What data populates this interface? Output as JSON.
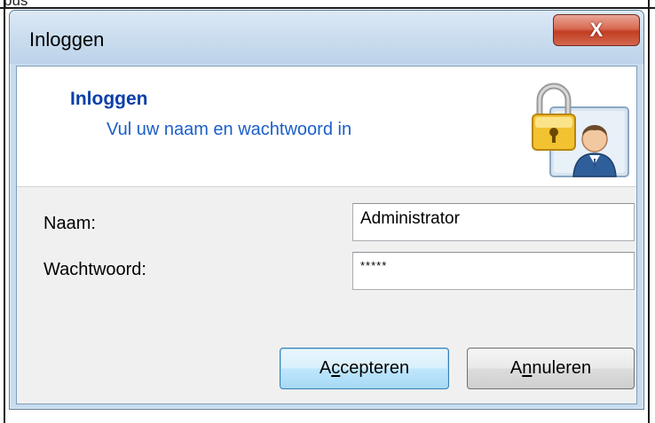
{
  "background": {
    "fragment_text": "pus"
  },
  "window": {
    "title": "Inloggen",
    "close_label": "X"
  },
  "header": {
    "title": "Inloggen",
    "subtitle": "Vul uw naam en wachtwoord in",
    "icon": "lock-user-icon"
  },
  "form": {
    "name_label": "Naam:",
    "name_value": "Administrator",
    "password_label": "Wachtwoord:",
    "password_value": "*****"
  },
  "buttons": {
    "accept": {
      "pre": "A",
      "mnemonic": "c",
      "post": "cepteren"
    },
    "cancel": {
      "pre": "A",
      "mnemonic": "n",
      "post": "nuleren"
    }
  },
  "colors": {
    "header_title": "#0a3fa8",
    "header_subtitle": "#1b5fc9",
    "close_button": "#c13e22",
    "window_frame": "#c7dcef"
  }
}
